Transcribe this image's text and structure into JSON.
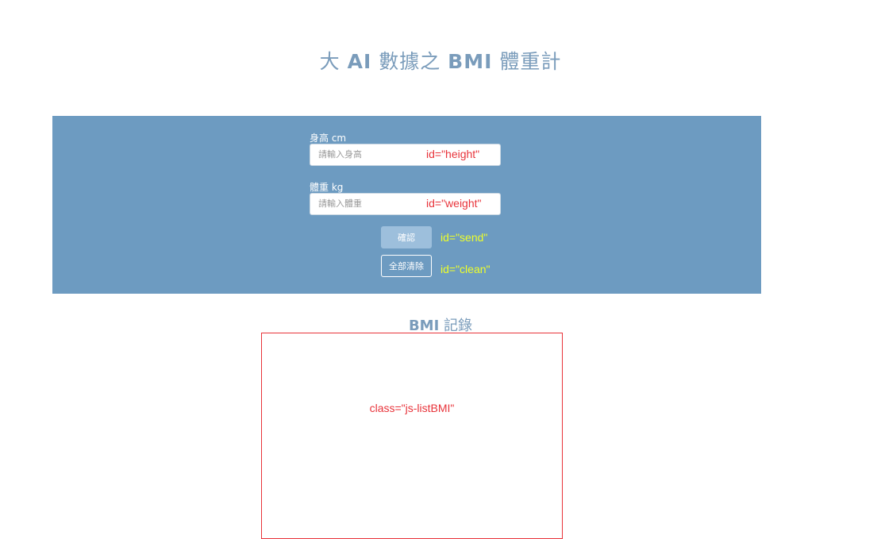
{
  "header": {
    "title_pre": "大 ",
    "title_ai": "AI",
    "title_mid": " 數據之 ",
    "title_bmi": "BMI",
    "title_post": " 體重計"
  },
  "form": {
    "height_label": "身高 cm",
    "height_placeholder": "請輸入身高",
    "height_annotation": "id=\"height\"",
    "weight_label": "體重 kg",
    "weight_placeholder": "請輸入體重",
    "weight_annotation": "id=\"weight\"",
    "send_label": "確認",
    "send_annotation": "id=\"send\"",
    "clean_label": "全部清除",
    "clean_annotation": "id=\"clean\""
  },
  "records": {
    "title_bmi": "BMI",
    "title_rest": " 記錄",
    "list_annotation": "class=\"js-listBMI\""
  },
  "colors": {
    "panel": "#6d9bc1",
    "title": "#7a9cbb",
    "annotation_red": "#e8333a",
    "annotation_yellow": "#eeff2a",
    "send_button": "#9dbfdc"
  }
}
